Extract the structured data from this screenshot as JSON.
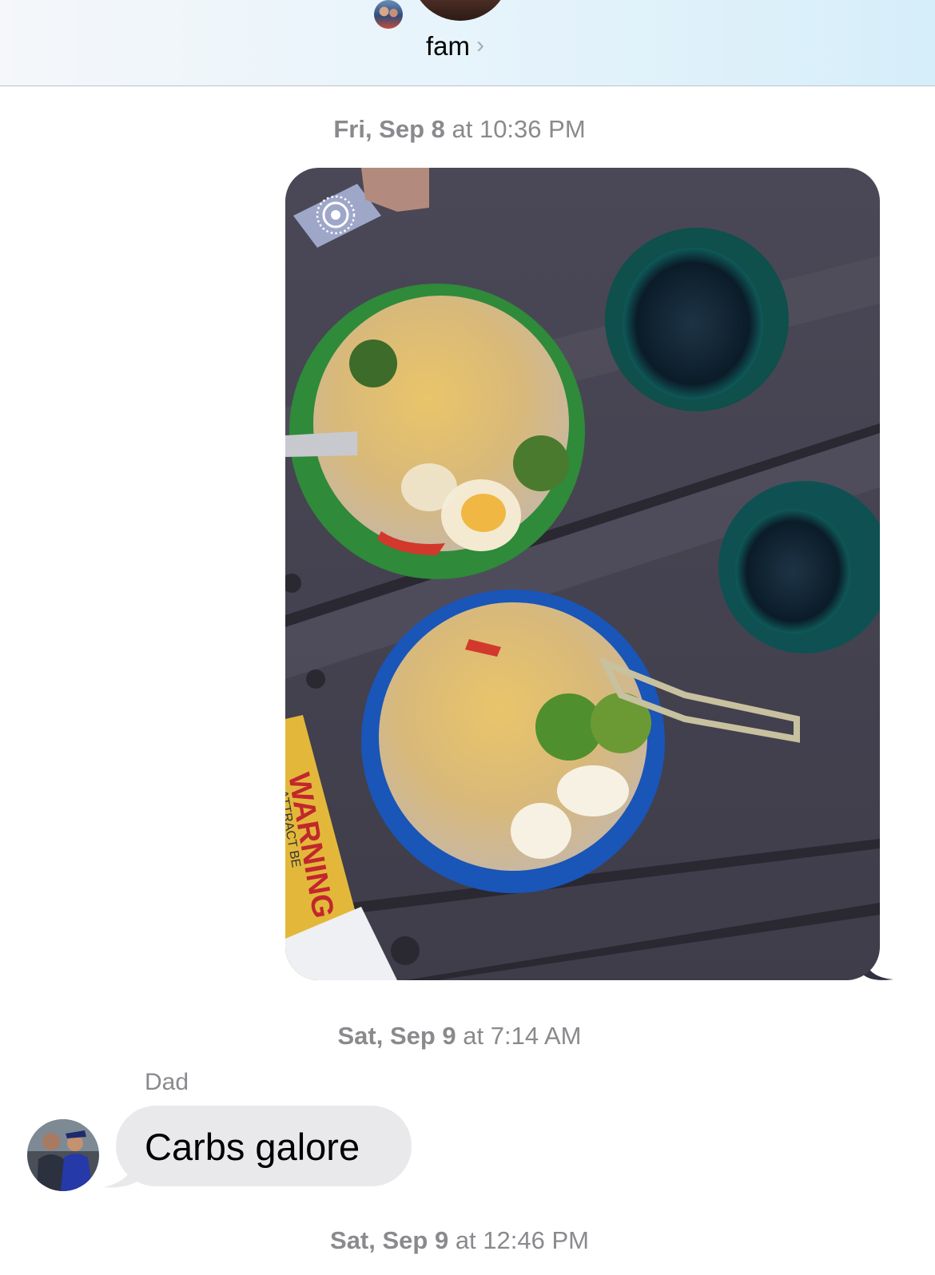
{
  "header": {
    "group_name": "fam",
    "chevron_icon": "chevron-right-icon"
  },
  "messages": {
    "timestamp_1": {
      "day": "Fri, Sep 8",
      "rest": " at 10:36 PM"
    },
    "photo": {
      "kind": "live-photo",
      "live_icon": "live-photo-icon",
      "package_text": "WARNING",
      "package_subtext": "ATTRACT BE"
    },
    "timestamp_2": {
      "day": "Sat, Sep 9",
      "rest": " at 7:14 AM"
    },
    "incoming": {
      "sender": "Dad",
      "text": "Carbs galore"
    },
    "timestamp_3": {
      "day": "Sat, Sep 9",
      "rest": " at 12:46 PM"
    }
  },
  "colors": {
    "incoming_bubble": "#e9e9eb",
    "timestamp": "#8a8a8e",
    "header_gradient_end": "#d6eefa"
  }
}
